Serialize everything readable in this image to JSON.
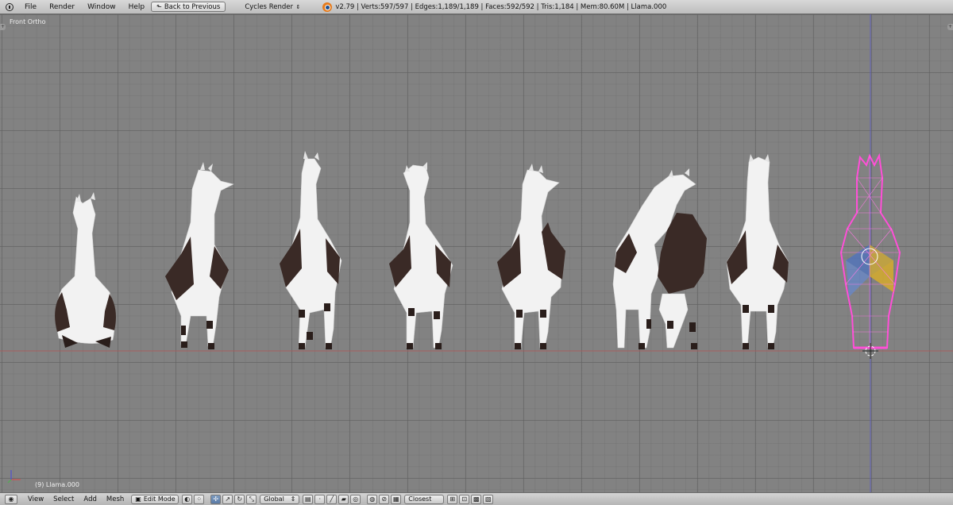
{
  "header": {
    "menus": [
      "File",
      "Render",
      "Window",
      "Help"
    ],
    "back_button": "Back to Previous",
    "render_engine": "Cycles Render",
    "stats": "v2.79 | Verts:597/597 | Edges:1,189/1,189 | Faces:592/592 | Tris:1,184 | Mem:80.60M | Llama.000"
  },
  "viewport": {
    "view_name": "Front Ortho",
    "active_object": "(9) Llama.000",
    "models": [
      "llama-sitting",
      "llama-walking-right-turn",
      "llama-stepping",
      "llama-looking-up",
      "llama-head-turned",
      "llama-grazing-back",
      "llama-standing",
      "llama-edit-mesh"
    ]
  },
  "footer": {
    "menus": [
      "View",
      "Select",
      "Add",
      "Mesh"
    ],
    "mode": "Edit Mode",
    "orientation": "Global",
    "snap_target": "Closest"
  },
  "colors": {
    "grid": "#828282",
    "llama_white": "#f2f2f2",
    "llama_brown": "#3a2a26",
    "mesh_wire": "#ff4fd8",
    "x_axis": "#c05050",
    "z_axis": "#5a5ac8"
  }
}
